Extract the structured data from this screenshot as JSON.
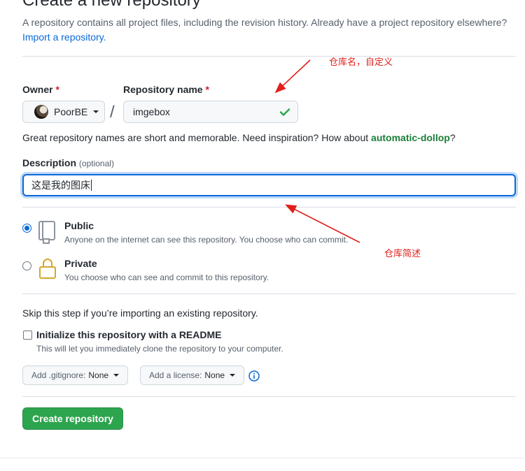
{
  "header": {
    "title": "Create a new repository",
    "intro": "A repository contains all project files, including the revision history. Already have a project repository elsewhere?",
    "import_link": "Import a repository."
  },
  "owner": {
    "label": "Owner",
    "required_mark": "*",
    "value": "PoorBE"
  },
  "separator": "/",
  "repo_name": {
    "label": "Repository name",
    "required_mark": "*",
    "value": "imgebox",
    "valid_icon": "check-icon"
  },
  "name_hint": {
    "prefix": "Great repository names are short and memorable. Need inspiration? How about ",
    "suggestion": "automatic-dollop",
    "suffix": "?"
  },
  "description": {
    "label": "Description",
    "optional_label": "(optional)",
    "value": "这是我的图床"
  },
  "visibility": {
    "options": [
      {
        "title": "Public",
        "note": "Anyone on the internet can see this repository. You choose who can commit.",
        "selected": true,
        "icon": "repo-icon"
      },
      {
        "title": "Private",
        "note": "You choose who can see and commit to this repository.",
        "selected": false,
        "icon": "lock-icon"
      }
    ]
  },
  "init": {
    "skip_text": "Skip this step if you’re importing an existing repository.",
    "readme_label": "Initialize this repository with a README",
    "readme_note": "This will let you immediately clone the repository to your computer.",
    "readme_checked": false
  },
  "gitignore": {
    "key": "Add .gitignore:",
    "value": "None"
  },
  "license": {
    "key": "Add a license:",
    "value": "None"
  },
  "submit": {
    "label": "Create repository"
  },
  "annotations": {
    "name_note": "仓库名，自定义",
    "desc_note": "仓库简述"
  },
  "colors": {
    "accent": "#0969da",
    "primary_button": "#2da44e",
    "required": "#cf222e",
    "suggestion": "#1a7f37",
    "annotation": "#e0201b"
  }
}
